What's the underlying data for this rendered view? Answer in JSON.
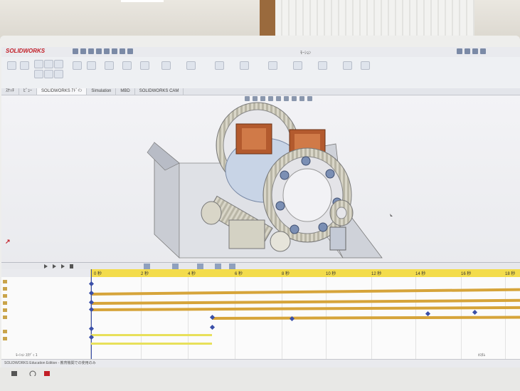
{
  "app": {
    "logo_text": "SOLIDWORKS",
    "window_title": "ﾓｰｼｮﾝ"
  },
  "cmd_tabs": [
    "ｽｹｯﾁ",
    "ﾋﾞｭｰ",
    "SOLIDWORKS ｱﾄﾞｲﾝ",
    "Simulation",
    "MBD",
    "SOLIDWORKS CAM"
  ],
  "ruler_ticks": [
    "0 秒",
    "2 秒",
    "4 秒",
    "6 秒",
    "8 秒",
    "10 秒",
    "12 秒",
    "14 秒",
    "16 秒",
    "18 秒"
  ],
  "timeline": {
    "tab_label": "ﾓｰｼｮﾝ ｽﾀﾃﾞｨ 1",
    "edition_text": "SOLIDWORKS Education Edition - 教育機関での使用のみ",
    "status_right": "ｶｽﾀﾑ"
  },
  "colors": {
    "accent": "#c21e26",
    "ruler": "#f3dc4c",
    "bar": "#d6a43a",
    "key": "#3a4fa8"
  }
}
